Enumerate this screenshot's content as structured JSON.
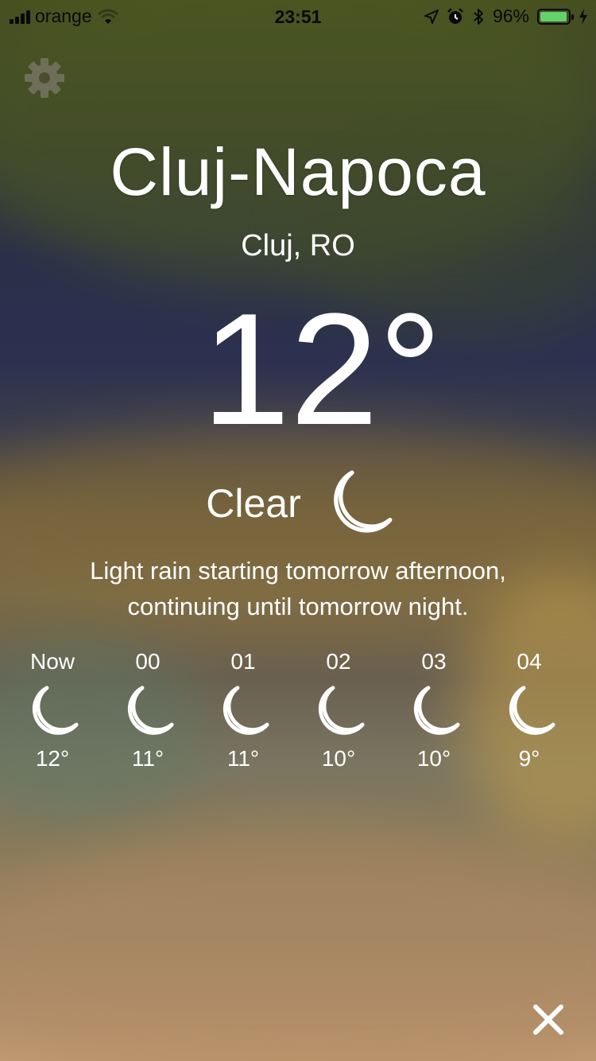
{
  "status_bar": {
    "carrier": "orange",
    "time": "23:51",
    "battery_percent": "96%",
    "battery_level": 0.96,
    "icons": [
      "signal-icon",
      "wifi-icon",
      "location-arrow-icon",
      "alarm-icon",
      "bluetooth-icon",
      "battery-icon",
      "charging-bolt-icon"
    ]
  },
  "location": {
    "city": "Cluj-Napoca",
    "region": "Cluj, RO"
  },
  "current": {
    "temperature": "12°",
    "condition": "Clear",
    "condition_icon": "moon-icon"
  },
  "summary": "Light rain starting tomorrow afternoon, continuing until tomorrow night.",
  "hourly": [
    {
      "label": "Now",
      "temp": "12°",
      "icon": "moon-icon"
    },
    {
      "label": "00",
      "temp": "11°",
      "icon": "moon-icon"
    },
    {
      "label": "01",
      "temp": "11°",
      "icon": "moon-icon"
    },
    {
      "label": "02",
      "temp": "10°",
      "icon": "moon-icon"
    },
    {
      "label": "03",
      "temp": "10°",
      "icon": "moon-icon"
    },
    {
      "label": "04",
      "temp": "9°",
      "icon": "moon-icon"
    }
  ],
  "controls": {
    "settings_icon": "gear-icon",
    "close_icon": "close-icon"
  },
  "colors": {
    "text": "#ffffff",
    "battery_fill": "#63d26b",
    "status_text": "#0a0a0a"
  }
}
